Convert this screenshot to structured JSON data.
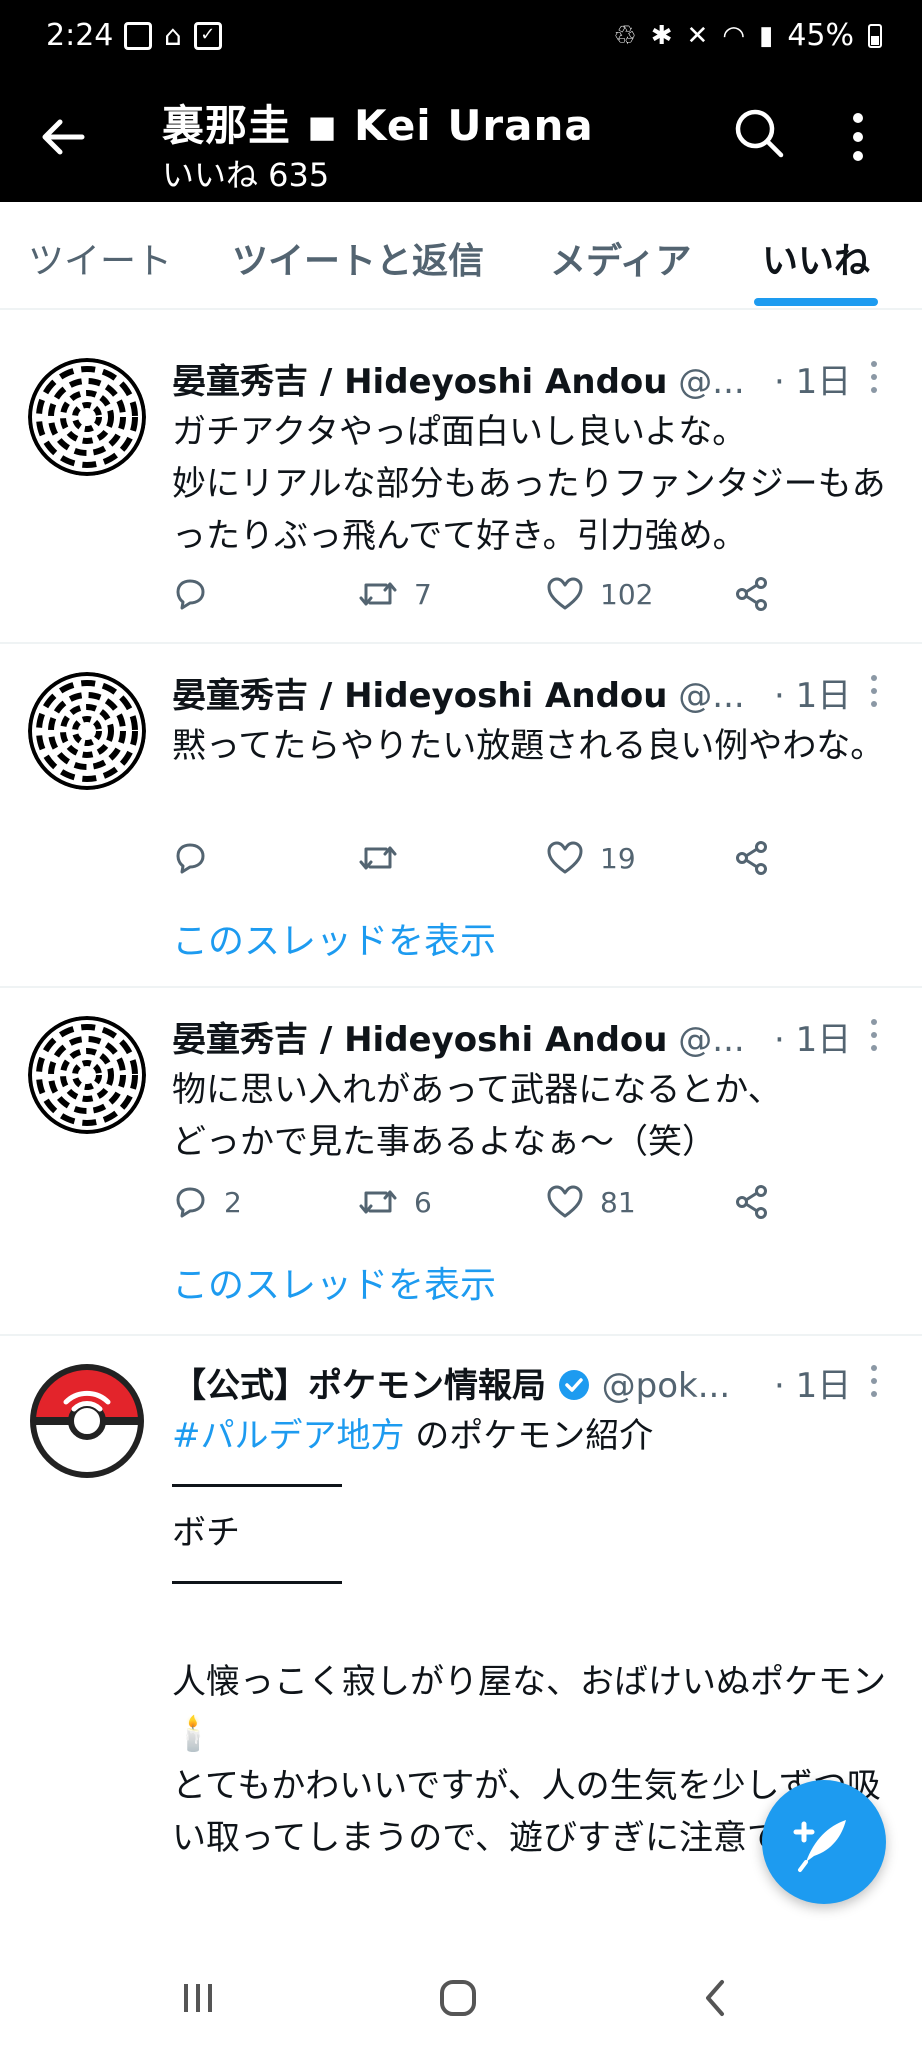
{
  "status_bar": {
    "time": "2:24",
    "battery": "45%",
    "icons": [
      "image-icon",
      "home-icon",
      "check-icon",
      "recycle-icon",
      "bluetooth-icon",
      "mute-icon",
      "wifi-icon",
      "signal-icon",
      "battery-icon"
    ]
  },
  "header": {
    "title": "裏那圭 ◾ Kei Urana",
    "subtitle": "いいね 635"
  },
  "tabs": [
    {
      "label": "ツイート"
    },
    {
      "label": "ツイートと返信"
    },
    {
      "label": "メディア"
    },
    {
      "label": "いいね",
      "active": true
    }
  ],
  "tweets": [
    {
      "name": "晏童秀吉 / Hideyoshi Andou",
      "handle": "@...",
      "time": "· 1日",
      "text": "ガチアクタやっぱ面白いし良いよな。\n妙にリアルな部分もあったりファンタジーもあったりぶっ飛んでて好き。引力強め。",
      "replies": "",
      "retweets": "7",
      "likes": "102"
    },
    {
      "name": "晏童秀吉 / Hideyoshi Andou",
      "handle": "@...",
      "time": "· 1日",
      "text": "黙ってたらやりたい放題される良い例やわな。",
      "replies": "",
      "retweets": "",
      "likes": "19",
      "thread_link": "このスレッドを表示"
    },
    {
      "name": "晏童秀吉 / Hideyoshi Andou",
      "handle": "@...",
      "time": "· 1日",
      "text": "物に思い入れがあって武器になるとか、\nどっかで見た事あるよなぁ～（笑）",
      "replies": "2",
      "retweets": "6",
      "likes": "81",
      "thread_link": "このスレッドを表示"
    },
    {
      "name": "【公式】ポケモン情報局",
      "handle": "@pok...",
      "time": "· 1日",
      "hashtag": "#パルデア地方",
      "text_after_hashtag": " のポケモン紹介",
      "line2": "ボチ",
      "para": "人懐っこく寂しがり屋な、おばけいぬポケモン🕯️\nとてもかわいいですが、人の生気を少しずつ吸い取ってしまうので、遊びすぎに注意です…😨"
    }
  ],
  "colors": {
    "accent": "#1d9bf0",
    "text": "#0f1419",
    "muted": "#536471",
    "header_bg": "#000000",
    "divider": "#eff3f4"
  }
}
